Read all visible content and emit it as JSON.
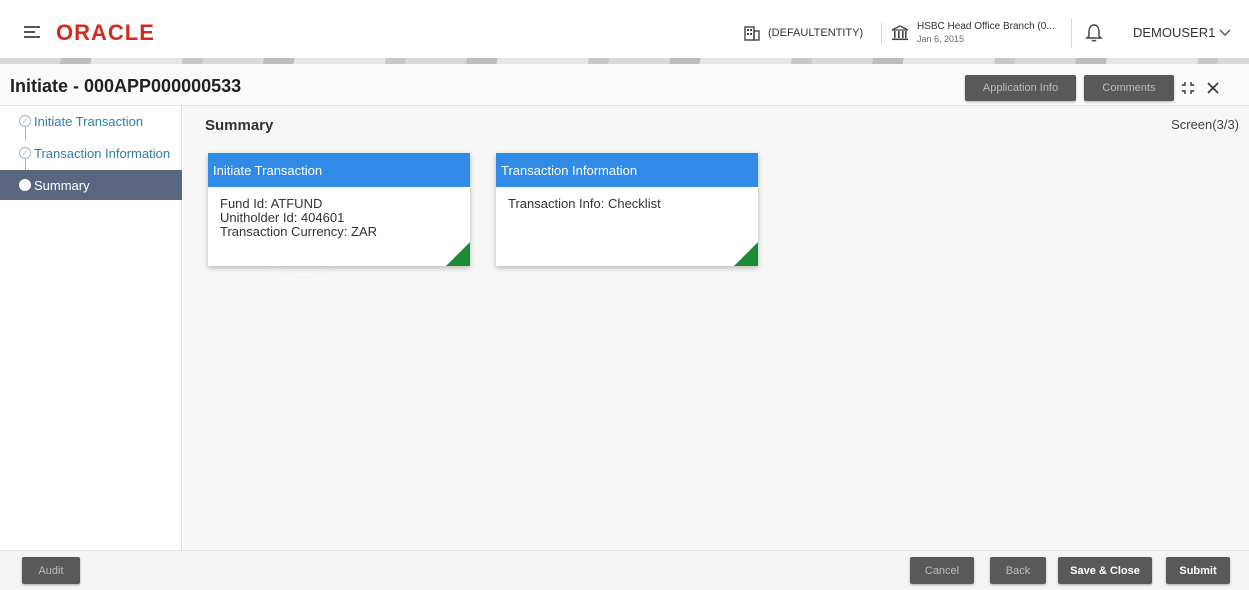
{
  "header": {
    "logo": "ORACLE",
    "entity": "(DEFAULTENTITY)",
    "branch": {
      "name": "HSBC Head Office Branch (0...",
      "date": "Jan 6, 2015"
    },
    "user": "DEMOUSER1"
  },
  "titlebar": {
    "title": "Initiate - 000APP000000533",
    "application_info": "Application Info",
    "comments": "Comments"
  },
  "sidebar": {
    "steps": [
      {
        "label": "Initiate Transaction"
      },
      {
        "label": "Transaction Information"
      },
      {
        "label": "Summary"
      }
    ]
  },
  "main": {
    "title": "Summary",
    "screen": "Screen(3/3)",
    "cards": [
      {
        "title": "Initiate Transaction",
        "lines": [
          "Fund Id: ATFUND",
          "Unitholder Id: 404601",
          "Transaction Currency: ZAR"
        ]
      },
      {
        "title": "Transaction Information",
        "lines": [
          "Transaction Info: Checklist"
        ]
      }
    ]
  },
  "footer": {
    "audit": "Audit",
    "cancel": "Cancel",
    "back": "Back",
    "save_close": "Save & Close",
    "submit": "Submit"
  },
  "colors": {
    "brand": "#d52b1e",
    "card_header": "#2f8be6",
    "corner": "#1f8a33",
    "active_step": "#5a6680",
    "button": "#595959"
  }
}
